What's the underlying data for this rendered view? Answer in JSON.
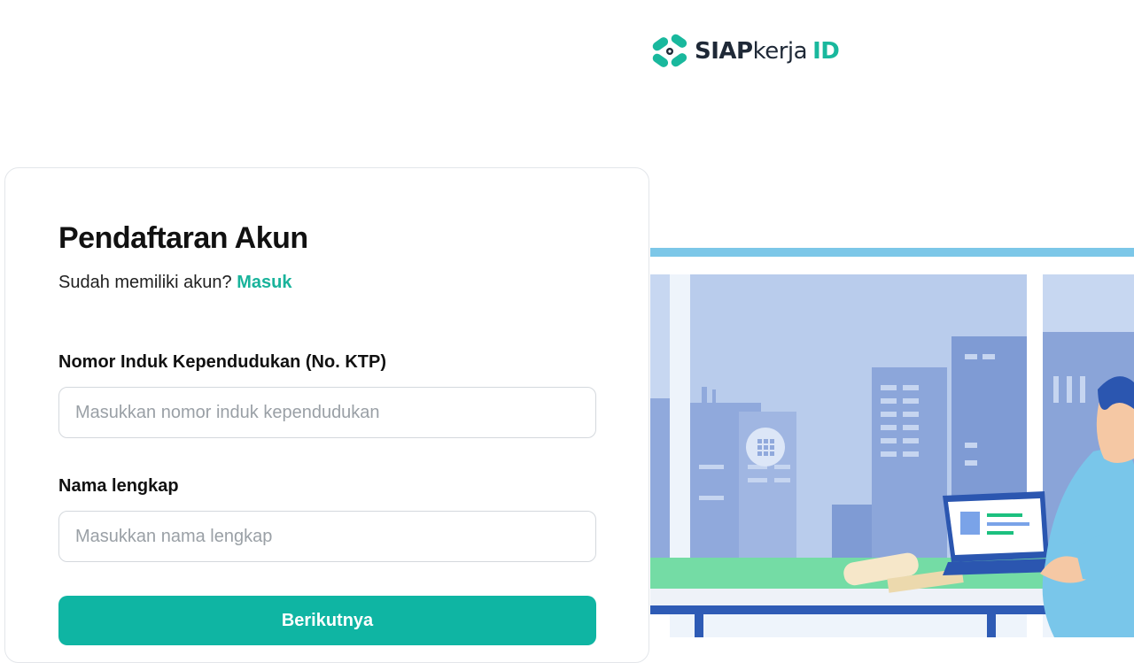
{
  "brand": {
    "siap": "SIAP",
    "kerja": "kerja",
    "id": "ID",
    "accent": "#19b89d"
  },
  "form": {
    "title": "Pendaftaran Akun",
    "has_account_text": "Sudah memiliki akun?",
    "login_link": "Masuk",
    "nik_label": "Nomor Induk Kependudukan (No. KTP)",
    "nik_value": "",
    "nik_placeholder": "Masukkan nomor induk kependudukan",
    "name_label": "Nama lengkap",
    "name_value": "",
    "name_placeholder": "Masukkan nama lengkap",
    "next_button": "Berikutnya",
    "button_color": "#0fb5a3"
  },
  "illustration": {
    "icon": "office-worker-laptop-illustration"
  }
}
